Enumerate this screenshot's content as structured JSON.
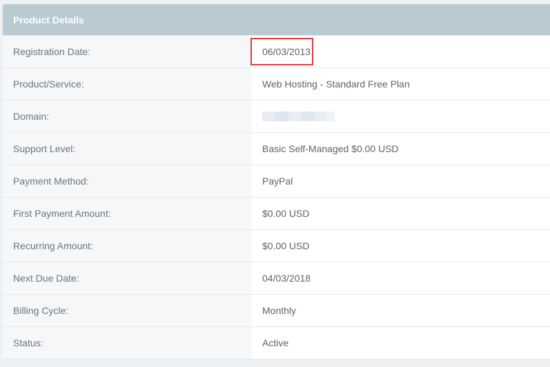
{
  "panel": {
    "title": "Product Details"
  },
  "rows": [
    {
      "label": "Registration Date:",
      "value": "06/03/2013"
    },
    {
      "label": "Product/Service:",
      "value": "Web Hosting - Standard Free Plan"
    },
    {
      "label": "Domain:",
      "value": ""
    },
    {
      "label": "Support Level:",
      "value": "Basic Self-Managed $0.00 USD"
    },
    {
      "label": "Payment Method:",
      "value": "PayPal"
    },
    {
      "label": "First Payment Amount:",
      "value": "$0.00 USD"
    },
    {
      "label": "Recurring Amount:",
      "value": "$0.00 USD"
    },
    {
      "label": "Next Due Date:",
      "value": "04/03/2018"
    },
    {
      "label": "Billing Cycle:",
      "value": "Monthly"
    },
    {
      "label": "Status:",
      "value": "Active"
    }
  ],
  "colors": {
    "header_bg": "#b9cad3",
    "label_bg": "#f5f7f9",
    "highlight": "#e23b3b"
  }
}
